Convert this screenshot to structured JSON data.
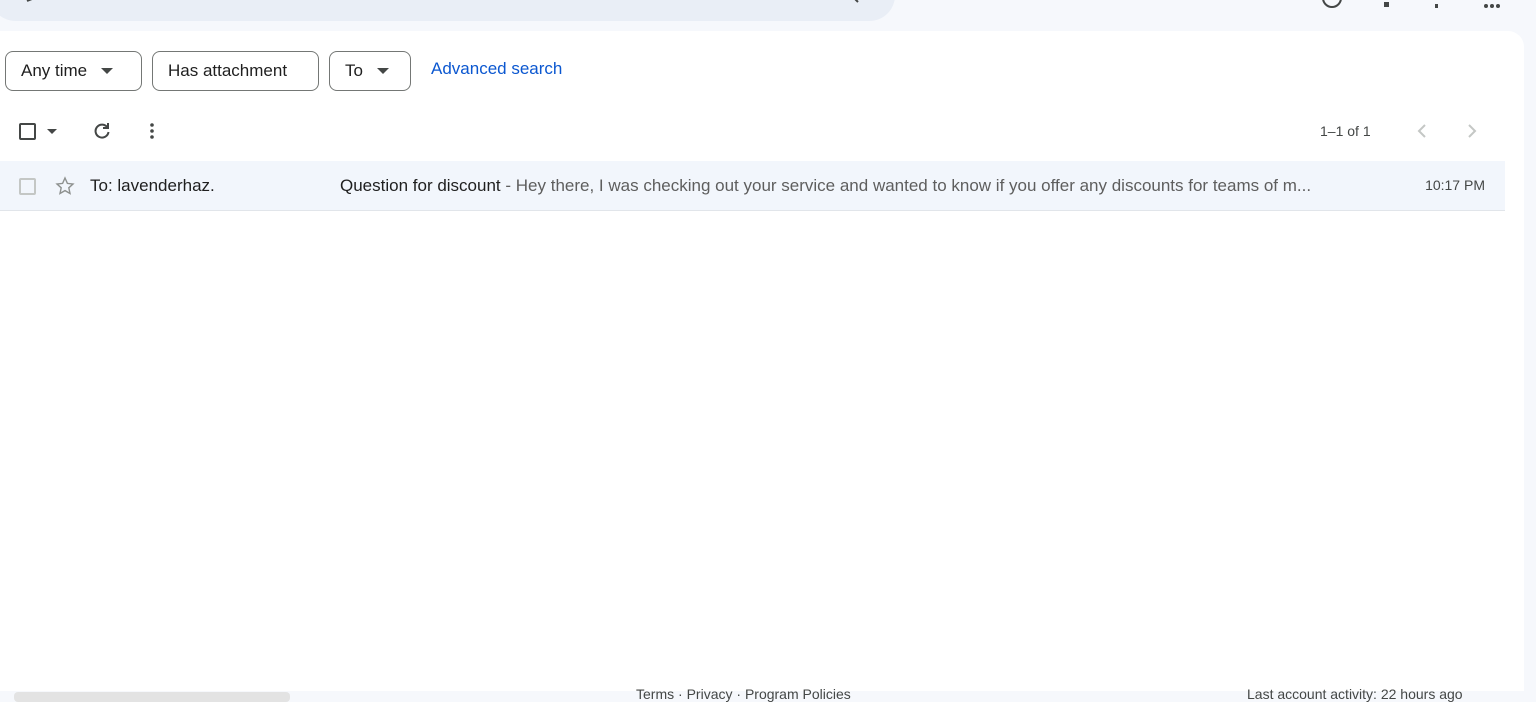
{
  "filters": {
    "any_time": "Any time",
    "has_attachment": "Has attachment",
    "to": "To",
    "advanced_search": "Advanced search"
  },
  "toolbar": {
    "page_count": "1–1 of 1",
    "icons": [
      "checkbox-icon",
      "caret-down-icon",
      "refresh-icon",
      "more-vert-icon",
      "chevron-left-icon",
      "chevron-right-icon"
    ]
  },
  "emails": [
    {
      "sender": "To: lavenderhaz.",
      "subject": "Question for discount",
      "separator": " - ",
      "snippet": "Hey there, I was checking out your service and wanted to know if you offer any discounts for teams of m...",
      "time": "10:17 PM",
      "starred": false
    }
  ],
  "footer": {
    "terms": "Terms",
    "privacy": "Privacy",
    "program_policies": "Program Policies",
    "sep": " · ",
    "last_activity": "Last account activity: 22 hours ago"
  },
  "colors": {
    "background": "#f6f8fc",
    "panel": "#ffffff",
    "accent_link": "#0b57d0",
    "row_read": "#f2f6fc"
  }
}
